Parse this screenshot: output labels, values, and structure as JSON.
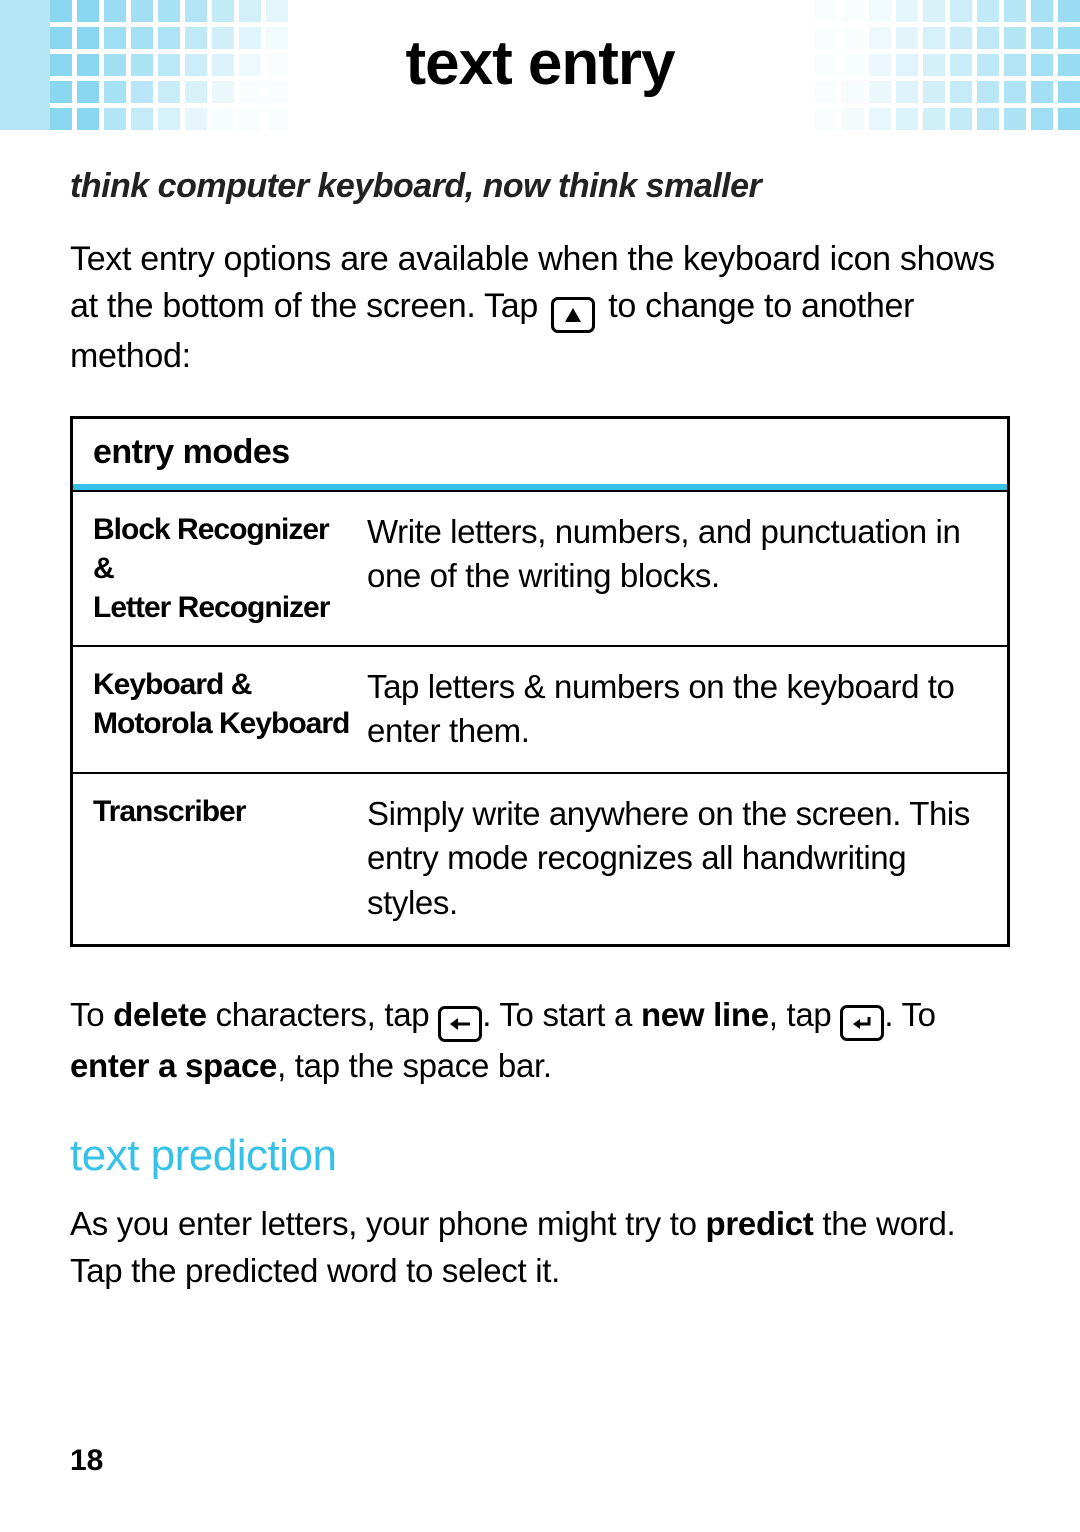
{
  "title": "text entry",
  "subtitle": "think computer keyboard, now think smaller",
  "intro_before": "Text entry options are available when the keyboard icon shows at the bottom of the screen. Tap ",
  "intro_after": " to change to another method:",
  "table": {
    "header": "entry modes",
    "rows": [
      {
        "label1": "Block Recognizer",
        "amp1": " & ",
        "label2": "Letter Recognizer",
        "desc": "Write letters, numbers, and punctuation in one of the writing blocks."
      },
      {
        "label1": "Keyboard",
        "amp1": " & ",
        "label2": "Motorola Keyboard",
        "desc": "Tap letters & numbers on the keyboard to enter them."
      },
      {
        "label1": "Transcriber",
        "amp1": "",
        "label2": "",
        "desc": "Simply write anywhere on the screen. This entry mode recognizes all handwriting styles."
      }
    ]
  },
  "after": {
    "t1": "To ",
    "b1": "delete",
    "t2": " characters, tap ",
    "t3": ". To start a ",
    "b2": "new line",
    "t4": ", tap ",
    "t5": ". To ",
    "b3": "enter a space",
    "t6": ", tap the space bar."
  },
  "section2_heading": "text prediction",
  "section2_before": "As you enter letters, your phone might try to ",
  "section2_bold": "predict",
  "section2_after": " the word. Tap the predicted word to select it.",
  "page_number": "18",
  "colors": {
    "accent": "#35c1e8",
    "deco": "#b4e6f6"
  }
}
